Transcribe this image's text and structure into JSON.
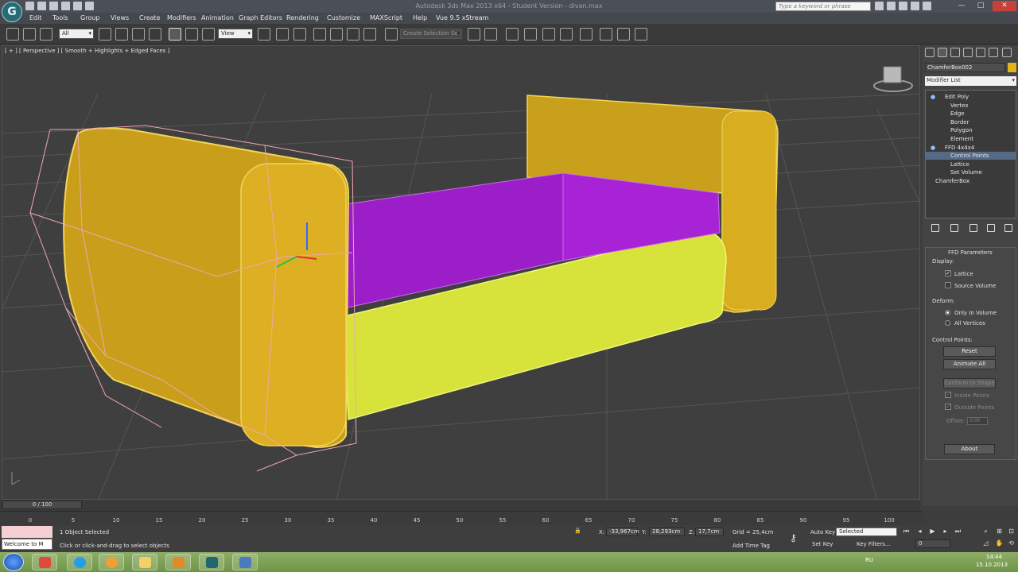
{
  "app": {
    "title": "Autodesk 3ds Max 2013 x64 - Student Version - divan.max",
    "logo_icon": "3ds-max-logo-icon",
    "search_placeholder": "Type a keyword or phrase",
    "window_controls": [
      "—",
      "□",
      "✕"
    ]
  },
  "menu": [
    "Edit",
    "Tools",
    "Group",
    "Views",
    "Create",
    "Modifiers",
    "Animation",
    "Graph Editors",
    "Rendering",
    "Customize",
    "MAXScript",
    "Help",
    "Vue 9.5 xStream"
  ],
  "toolbar": {
    "selection_filter": "All",
    "ref_coord": "View",
    "named_selection_placeholder": "Create Selection Se"
  },
  "viewport": {
    "label": "[ + ] [ Perspective ] [ Smooth + Highlights + Edged Faces ]",
    "bg_color": "#3f3f3f",
    "grid_color": "#555555",
    "arm_color": "#e3b419",
    "seat_color": "#a21fd1",
    "base_color": "#e5f141",
    "lattice_color": "#f0a6b0"
  },
  "command_panel": {
    "object_name": "ChamferBox002",
    "object_color": "#e3b419",
    "modifier_list": "Modifier List",
    "stack": [
      {
        "label": "Edit Poly",
        "level": 0,
        "selected": false
      },
      {
        "label": "Vertex",
        "level": 1,
        "selected": false
      },
      {
        "label": "Edge",
        "level": 1,
        "selected": false
      },
      {
        "label": "Border",
        "level": 1,
        "selected": false
      },
      {
        "label": "Polygon",
        "level": 1,
        "selected": false
      },
      {
        "label": "Element",
        "level": 1,
        "selected": false
      },
      {
        "label": "FFD 4x4x4",
        "level": 0,
        "selected": false
      },
      {
        "label": "Control Points",
        "level": 1,
        "selected": true
      },
      {
        "label": "Lattice",
        "level": 1,
        "selected": false
      },
      {
        "label": "Set Volume",
        "level": 1,
        "selected": false
      },
      {
        "label": "ChamferBox",
        "level": 0,
        "selected": false
      }
    ],
    "rollout": {
      "title": "FFD Parameters",
      "display_label": "Display:",
      "lattice": "Lattice",
      "lattice_checked": true,
      "source_volume": "Source Volume",
      "source_volume_checked": false,
      "deform_label": "Deform:",
      "only_in_volume": "Only In Volume",
      "all_vertices": "All Vertices",
      "deform_selected": "Only In Volume",
      "control_points_label": "Control Points:",
      "reset": "Reset",
      "animate_all": "Animate All",
      "conform": "Conform to Shape",
      "inside_points": "Inside Points",
      "outside_points": "Outside Points",
      "offset_label": "Offset:",
      "offset_value": "0,05",
      "about": "About"
    }
  },
  "timeline": {
    "counter": "0 / 100",
    "ticks": [
      0,
      5,
      10,
      15,
      20,
      25,
      30,
      35,
      40,
      45,
      50,
      55,
      60,
      65,
      70,
      75,
      80,
      85,
      90,
      95,
      100
    ]
  },
  "status": {
    "maxscript_text": "Welcome to M",
    "selection_text": "1 Object Selected",
    "prompt_text": "Click or click-and-drag to select objects",
    "x_label": "X:",
    "x_value": "-33,967cm",
    "y_label": "Y:",
    "y_value": "28,293cm",
    "z_label": "Z:",
    "z_value": "17,7cm",
    "grid_text": "Grid = 25,4cm",
    "add_time_tag": "Add Time Tag",
    "auto_key": "Auto Key",
    "auto_key_value": "Selected",
    "set_key": "Set Key",
    "key_filters": "Key Filters...",
    "frame_value": "0"
  },
  "taskbar": {
    "lang": "RU",
    "time": "14:44",
    "date": "15.10.2013",
    "apps": [
      "chrome-icon",
      "skype-icon",
      "media-player-icon",
      "folder-icon",
      "word-icon",
      "3ds-max-icon",
      "app-window-icon"
    ]
  }
}
